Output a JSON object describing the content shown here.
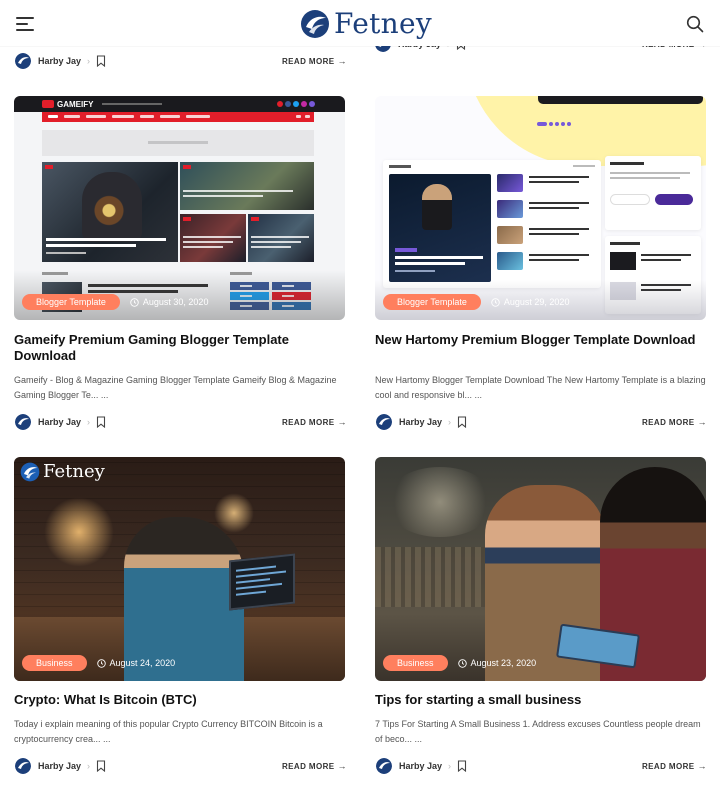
{
  "header": {
    "logo_text": "Fetney",
    "menu_icon": "hamburger-menu-icon",
    "search_icon": "search-icon"
  },
  "colors": {
    "brand": "#1c3f7a",
    "category_badge": "#ff7f5e"
  },
  "read_more_label": "READ MORE",
  "top_meta": [
    {
      "author": "Harby Jay"
    },
    {
      "author": "Harby Jay"
    }
  ],
  "posts": [
    {
      "category": "Blogger Template",
      "date": "August 30, 2020",
      "title": "Gameify Premium Gaming Blogger Template Download",
      "excerpt": "Gameify - Blog & Magazine Gaming Blogger Template Gameify Blog & Magazine Gaming Blogger Te... ...",
      "author": "Harby Jay",
      "preview": {
        "brand": "GAMEIFY",
        "ad_label": "Responsive Advertisement",
        "main_caption": "This year's Battlefield is rumored to be set during World War 2",
        "section_latest": "LATEST NEWS",
        "section_follow": "FOLLOW US"
      }
    },
    {
      "category": "Blogger Template",
      "date": "August 29, 2020",
      "title": "New Hartomy Premium Blogger Template Download",
      "excerpt": "New Hartomy Blogger Template Download The New Hartomy Template  is a blazing cool and responsive bl... ...",
      "author": "Harby Jay",
      "preview": {
        "section_label": "ANDROID",
        "featured_caption": "Director Landing Page Blogger Template Free Download",
        "follow_title": "Follow by Email",
        "popular_title": "Popular Posts"
      }
    },
    {
      "category": "Business",
      "date": "August 24, 2020",
      "title": "Crypto: What Is Bitcoin (BTC)",
      "excerpt": "Today i explain meaning of this popular Crypto Currency BITCOIN  Bitcoin is a cryptocurrency crea... ...",
      "author": "Harby Jay",
      "preview": {
        "logo_text": "Fetney"
      }
    },
    {
      "category": "Business",
      "date": "August 23, 2020",
      "title": "Tips for starting a small business",
      "excerpt": "7 Tips For Starting A Small Business 1. Address excuses Countless people dream of beco... ...",
      "author": "Harby Jay"
    }
  ]
}
